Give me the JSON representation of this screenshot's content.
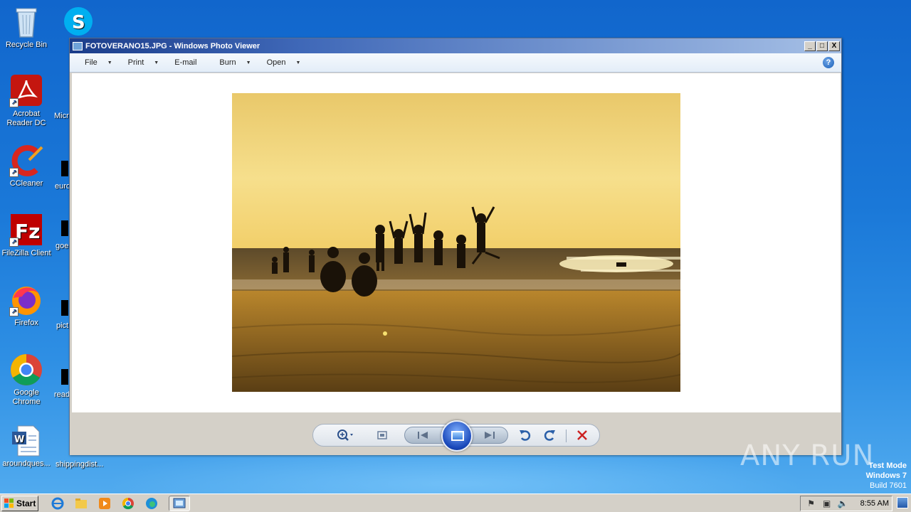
{
  "desktop": {
    "icons": [
      {
        "label": "Recycle Bin"
      },
      {
        "label": "Acrobat Reader DC"
      },
      {
        "label": "CCleaner"
      },
      {
        "label": "FileZilla Client"
      },
      {
        "label": "Firefox"
      },
      {
        "label": "Google Chrome"
      },
      {
        "label": "aroundques..."
      }
    ],
    "partial_icons": [
      {
        "label": "Micr"
      },
      {
        "label": "euro"
      },
      {
        "label": "goe"
      },
      {
        "label": "pict"
      },
      {
        "label": "read"
      },
      {
        "label": "shippingdist..."
      }
    ]
  },
  "window": {
    "title": "FOTOVERANO15.JPG - Windows Photo Viewer",
    "buttons": {
      "minimize": "_",
      "maximize": "□",
      "close": "X"
    },
    "menu": [
      {
        "label": "File"
      },
      {
        "label": "Print"
      },
      {
        "label": "E-mail"
      },
      {
        "label": "Burn"
      },
      {
        "label": "Open"
      }
    ],
    "help_label": "?"
  },
  "taskbar": {
    "start_label": "Start",
    "clock": "8:55 AM"
  },
  "watermark": {
    "text": "ANY RUN"
  },
  "os_info": {
    "line1": "Test Mode",
    "line2": "Windows 7",
    "line3": "Build 7601"
  },
  "colors": {
    "titlebar_start": "#1b3d8a",
    "desktop_blue": "#1a78d8",
    "sky": "#f2cf6a",
    "sand": "#8a6220"
  }
}
